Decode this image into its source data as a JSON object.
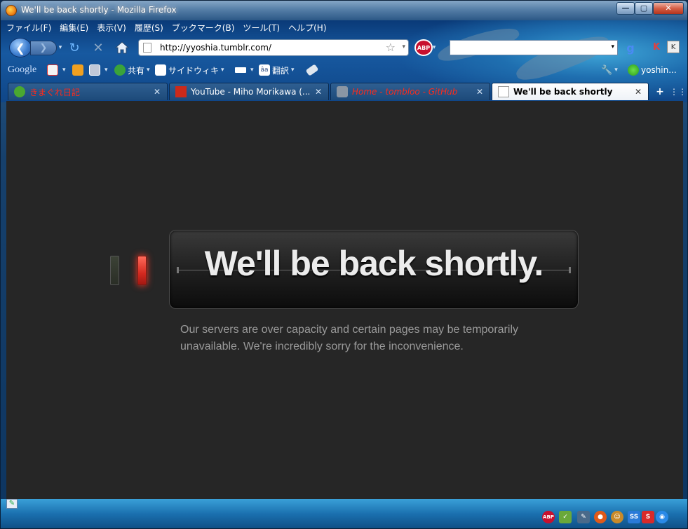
{
  "window": {
    "title": "We'll be back shortly - Mozilla Firefox",
    "buttons": {
      "minimize": "—",
      "maximize": "▢",
      "close": "✕"
    }
  },
  "menubar": {
    "items": [
      "ファイル(F)",
      "編集(E)",
      "表示(V)",
      "履歴(S)",
      "ブックマーク(B)",
      "ツール(T)",
      "ヘルプ(H)"
    ]
  },
  "navbar": {
    "back_glyph": "❮",
    "forward_glyph": "❯",
    "dropdown_glyph": "▾",
    "reload_glyph": "↻",
    "stop_glyph": "✕",
    "url": "http://yyoshia.tumblr.com/",
    "star_glyph": "☆",
    "abp_label": "ABP",
    "search_value": "",
    "google_label": "g",
    "kb1_label": "K",
    "kb2_label": "K"
  },
  "bookmarks": {
    "items": [
      {
        "label": "Google",
        "color": "#4a8af4"
      },
      {
        "label": "",
        "color": "#d33"
      },
      {
        "label": "",
        "color": "#f0a020"
      },
      {
        "label": "",
        "color": "#c0c8d8"
      },
      {
        "label": "共有",
        "color": "#3aa33a"
      },
      {
        "label": "サイドウィキ",
        "color": "#ffffff"
      },
      {
        "label": "",
        "color": "#ffffff"
      },
      {
        "label": "翻訳",
        "color": "#ffffff"
      },
      {
        "label": "",
        "color": "#dfe6ee"
      }
    ],
    "wrench_glyph": "🔧",
    "user_label": "yoshin..."
  },
  "tabs": [
    {
      "title": "きまぐれ日記",
      "icon_color": "#4aa830",
      "title_color": "#ff2a1a",
      "active": false
    },
    {
      "title": "YouTube - Miho Morikawa (...",
      "icon_color": "#cc2a1a",
      "title_color": "#ffffff",
      "active": false
    },
    {
      "title": "Home - tombloo - GitHub",
      "icon_color": "#8a96a4",
      "title_color": "#ff2a1a",
      "active": false
    },
    {
      "title": "We'll be back shortly",
      "icon_color": "#ffffff",
      "title_color": "#000000",
      "active": true
    }
  ],
  "tabbar": {
    "close_glyph": "✕",
    "new_tab_glyph": "+",
    "all_tabs_glyph": "⋮⋮"
  },
  "page": {
    "headline": "We'll be back shortly.",
    "message": "Our servers are over capacity and certain pages may be temporarily unavailable.  We're incredibly sorry for the inconvenience."
  },
  "statusbar": {
    "edit_glyph": "✎",
    "icons": [
      {
        "name": "abp-status-icon",
        "label": "ABP",
        "color": "#c8102e"
      },
      {
        "name": "note-status-icon",
        "label": "✓",
        "color": "#6aa83a"
      },
      {
        "name": "pen-status-icon",
        "label": "✎",
        "color": "#4a6a8a"
      },
      {
        "name": "ff-status-icon",
        "label": "●",
        "color": "#e05a1a"
      },
      {
        "name": "greasemonkey-icon",
        "label": "☺",
        "color": "#c88a2a"
      },
      {
        "name": "ss-status-icon",
        "label": "SS",
        "color": "#2a7ad8"
      },
      {
        "name": "s-status-icon",
        "label": "S",
        "color": "#d82a2a"
      },
      {
        "name": "globe-status-icon",
        "label": "◉",
        "color": "#2a8ae8"
      }
    ]
  },
  "colors": {
    "page_bg": "#262626",
    "headline": "#ececec",
    "message": "#9a9a9a",
    "active_light": "#ff3a2a"
  }
}
